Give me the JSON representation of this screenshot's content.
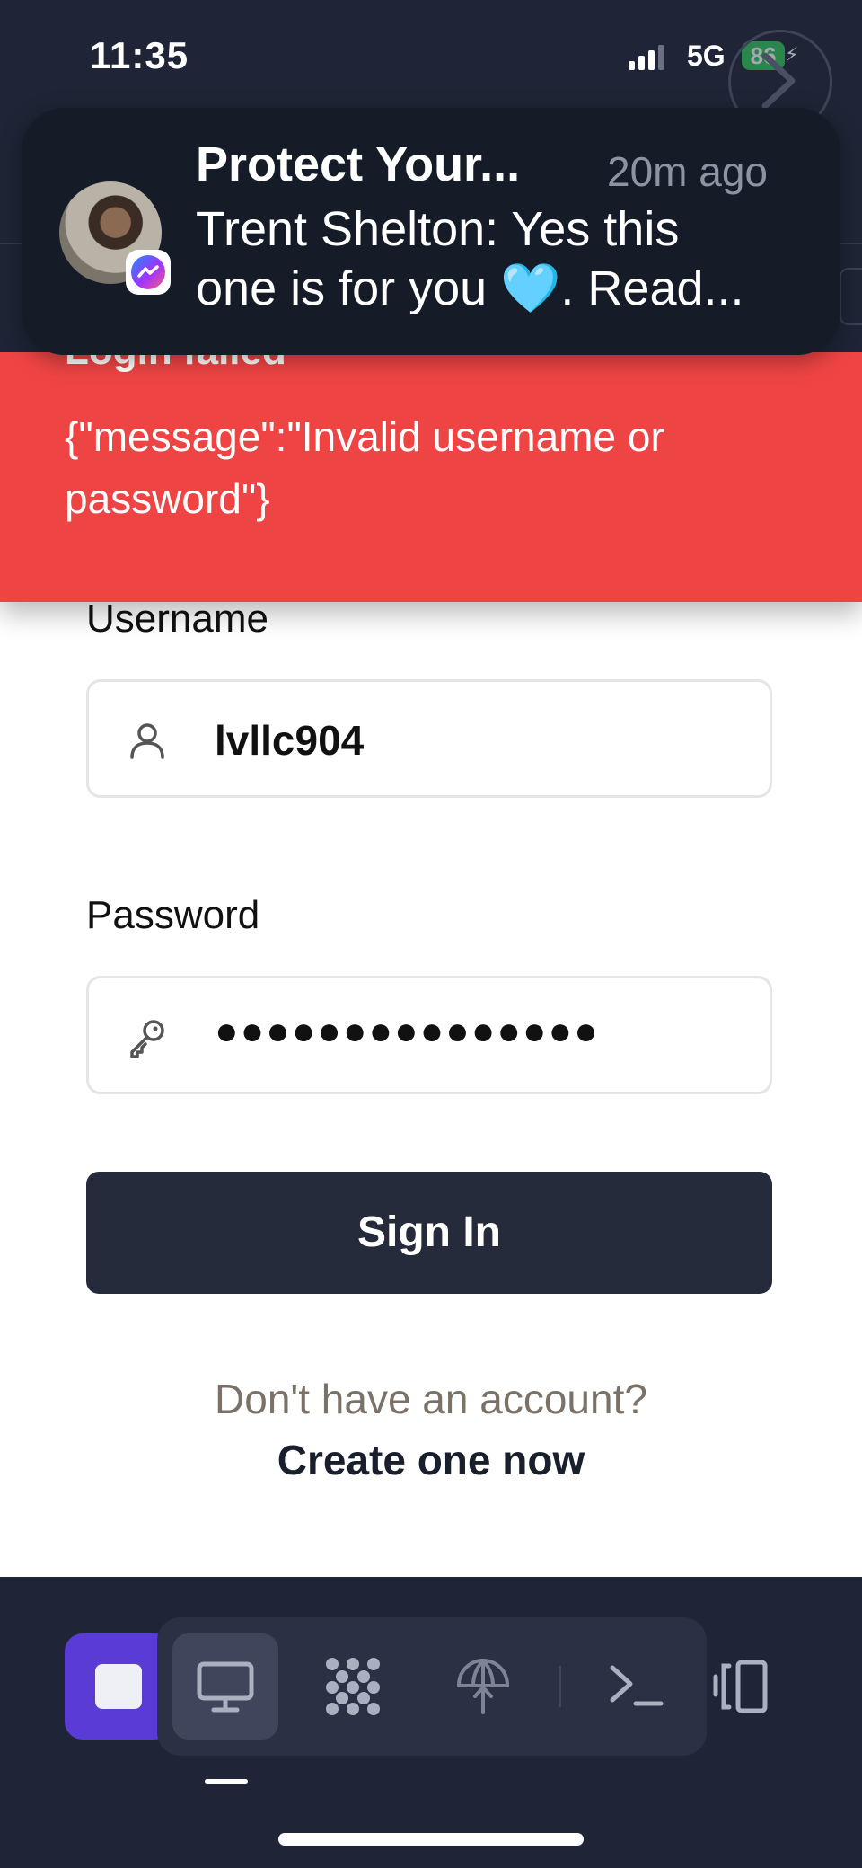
{
  "status_bar": {
    "time": "11:35",
    "network": "5G",
    "battery": "86"
  },
  "notification": {
    "app_icon": "messenger-icon",
    "title": "Protect Your...",
    "time_ago": "20m ago",
    "body_line1": "Trent Shelton: Yes this",
    "body_line2": "one is for you 🩵. Read..."
  },
  "error_toast": {
    "title": "Login failed",
    "message": "{\"message\":\"Invalid username or password\"}",
    "color": "#ef4444"
  },
  "form": {
    "username_label": "Username",
    "username_value": "lvllc904",
    "username_icon": "user-icon",
    "password_label": "Password",
    "password_value": "●●●●●●●●●●●●●●●",
    "password_icon": "key-icon",
    "signin_label": "Sign In",
    "no_account_text": "Don't have an account?",
    "create_link": "Create one now"
  },
  "toolbar": {
    "stop_icon": "stop-icon",
    "items": [
      "monitor-icon",
      "apps-grid-icon",
      "network-antenna-icon",
      "terminal-icon",
      "device-switch-icon"
    ],
    "accent": "#5b3bd6"
  }
}
